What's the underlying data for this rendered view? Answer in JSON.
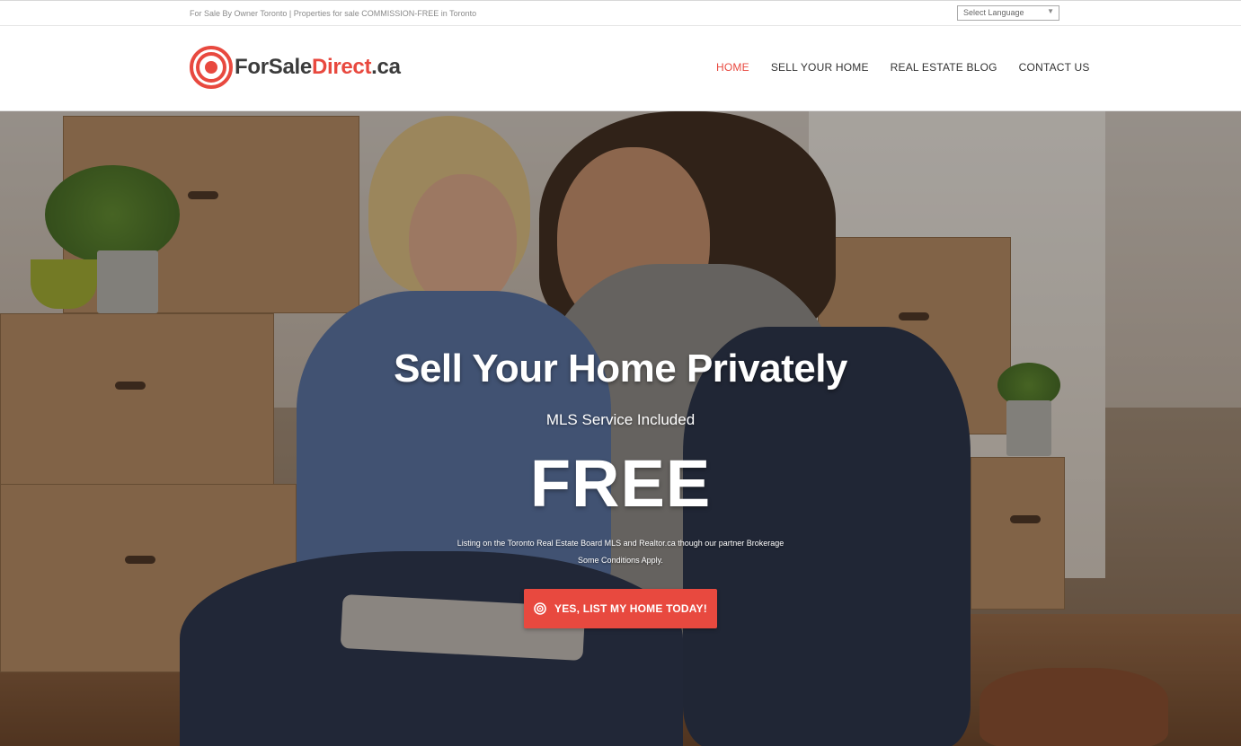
{
  "topbar": {
    "tagline": "For Sale By Owner Toronto | Properties for sale COMMISSION-FREE in Toronto",
    "language_select": "Select Language"
  },
  "header": {
    "logo_part1": "ForSale",
    "logo_part2": "Direct",
    "logo_part3": ".ca",
    "nav": [
      {
        "label": "HOME",
        "active": true
      },
      {
        "label": "SELL YOUR HOME"
      },
      {
        "label": "REAL ESTATE BLOG"
      },
      {
        "label": "CONTACT US"
      }
    ]
  },
  "hero": {
    "title": "Sell Your Home Privately",
    "subtitle": "MLS Service Included",
    "headline": "FREE",
    "line1": "Listing on the Toronto Real Estate Board MLS and Realtor.ca though our partner Brokerage",
    "line2": "Some Conditions Apply.",
    "cta_label": "YES, LIST MY HOME TODAY!"
  },
  "colors": {
    "accent": "#e8493f",
    "logo_dark": "#3b3b3b"
  },
  "icons": [
    "target-logo-icon",
    "target-icon",
    "chevron-down-icon"
  ]
}
